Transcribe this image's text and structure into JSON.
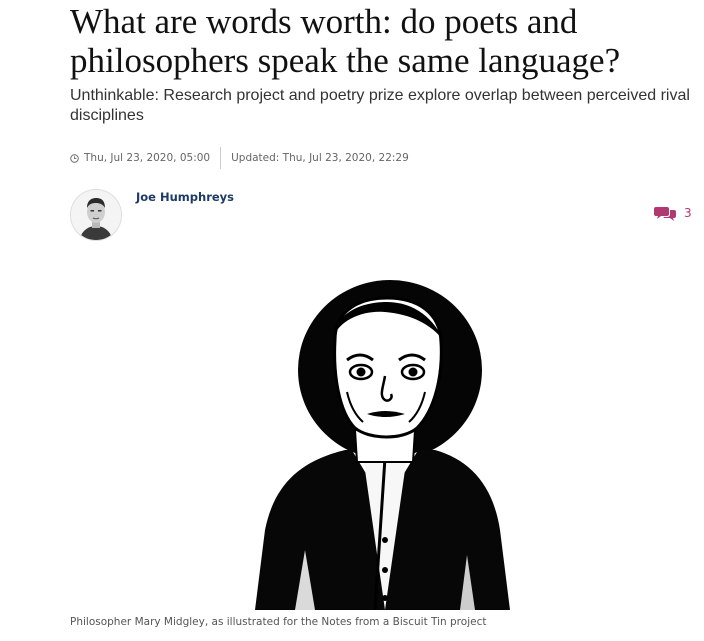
{
  "article": {
    "headline": "What are words worth: do poets and philosophers speak the same language?",
    "standfirst": "Unthinkable: Research project and poetry prize explore overlap between perceived rival disciplines",
    "published": "Thu, Jul 23, 2020, 05:00",
    "updated": "Updated: Thu, Jul 23, 2020, 22:29",
    "author": "Joe Humphreys",
    "comment_count": "3",
    "caption": "Philosopher Mary Midgley, as illustrated for the Notes from a Biscuit Tin project"
  },
  "icons": {
    "clock": "clock-icon",
    "comments": "speech-bubbles-icon"
  },
  "colors": {
    "author": "#1e3a66",
    "comments": "#b03a6f"
  }
}
